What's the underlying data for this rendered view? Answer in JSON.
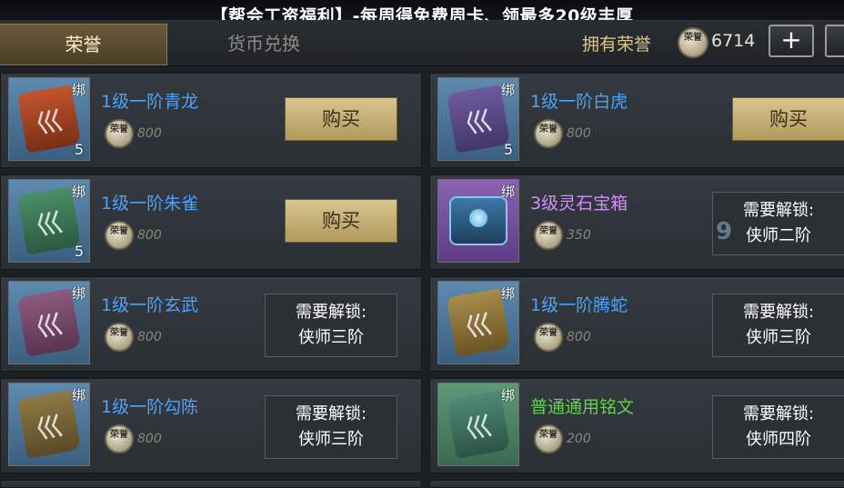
{
  "banner": {
    "text": "【帮会工资福利】-每周得免费周卡、领最多20级丰厚"
  },
  "tabs": {
    "honor": "荣誉",
    "exchange": "货币兑换"
  },
  "balance": {
    "label": "拥有荣誉",
    "coin_text": "荣誉",
    "value": "6714",
    "add_label": "+"
  },
  "buy_label": "购买",
  "bind_label": "绑",
  "coin_text": "荣誉",
  "items": [
    {
      "name": "1级一阶青龙",
      "price": "800",
      "qty": "5",
      "action": "buy",
      "rune": "巛"
    },
    {
      "name": "1级一阶白虎",
      "price": "800",
      "qty": "5",
      "action": "buy",
      "rune": "巛"
    },
    {
      "name": "1级一阶朱雀",
      "price": "800",
      "qty": "5",
      "action": "buy",
      "rune": "巛"
    },
    {
      "name": "3级灵石宝箱",
      "price": "350",
      "qty": "",
      "action": "locked",
      "lock_title": "需要解锁:",
      "lock_req": "侠师二阶"
    },
    {
      "name": "1级一阶玄武",
      "price": "800",
      "qty": "",
      "action": "locked",
      "lock_title": "需要解锁:",
      "lock_req": "侠师三阶",
      "rune": "巛"
    },
    {
      "name": "1级一阶腾蛇",
      "price": "800",
      "qty": "",
      "action": "locked",
      "lock_title": "需要解锁:",
      "lock_req": "侠师三阶",
      "rune": "巛"
    },
    {
      "name": "1级一阶勾陈",
      "price": "800",
      "qty": "",
      "action": "locked",
      "lock_title": "需要解锁:",
      "lock_req": "侠师三阶",
      "rune": "巛"
    },
    {
      "name": "普通通用铭文",
      "price": "200",
      "qty": "",
      "action": "locked",
      "lock_title": "需要解锁:",
      "lock_req": "侠师四阶",
      "rune": "巛"
    }
  ],
  "watermark": "9"
}
